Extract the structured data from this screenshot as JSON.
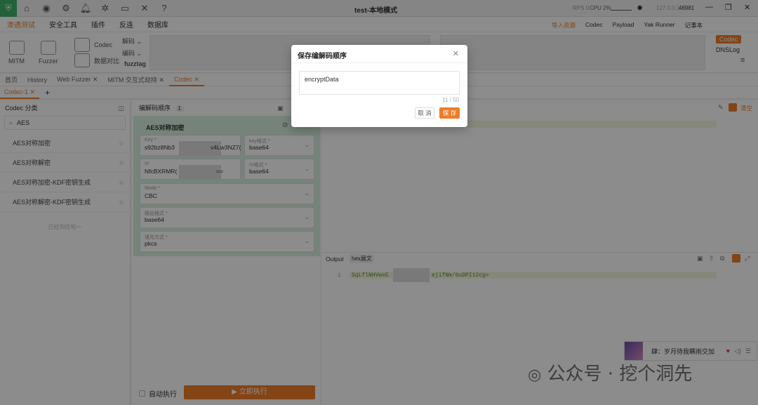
{
  "window": {
    "title": "test-本地模式",
    "rps": "RPS 0",
    "cpu": "CPU 2%",
    "ip": "127.0.0.1",
    "port": "46981"
  },
  "menu": [
    "渗透测试",
    "安全工具",
    "插件",
    "反连",
    "数据库"
  ],
  "right_menu": [
    "导入资源",
    "Codec",
    "Payload",
    "Yak Runner",
    "记事本"
  ],
  "tools": {
    "mitm": "MITM",
    "fuzzer": "Fuzzer",
    "codec": "Codec",
    "datacompare": "数据对比",
    "decode": "解码",
    "encode": "编码",
    "fuzztag": "fuzztag",
    "codec_tag": "Codec",
    "dnslog": "DNSLog"
  },
  "tabs": [
    "首页",
    "History",
    "Web Fuzzer",
    "MITM 交互式劫持",
    "Codec"
  ],
  "subtab": "Codec-1",
  "left_panel": {
    "title": "Codec 分类",
    "search_value": "AES",
    "items": [
      "AES对称加密",
      "AES对称解密",
      "AES对称加密-KDF密钥生成",
      "AES对称解密-KDF密钥生成"
    ],
    "footer": "已经到底啦～"
  },
  "mid_panel": {
    "title": "编解码顺序",
    "count": "1",
    "card_title": "AES对称加密",
    "fields": {
      "key_label": "Key *",
      "key_value_a": "s92bz8Nb3",
      "key_value_b": "v4Lw3NZ7(",
      "key_mode_label": "key格式 *",
      "key_mode": "base64",
      "iv_label": "IV",
      "iv_value_a": "NfcBXRMR(",
      "iv_value_b": "==",
      "iv_mode_label": "IV格式 *",
      "iv_mode": "base64",
      "mode_label": "Mode *",
      "mode": "CBC",
      "output_label": "输出格式 *",
      "output": "base64",
      "padding_label": "填充方式 *",
      "padding": "pkcs"
    },
    "auto_run": "自动执行",
    "run_now": "立即执行"
  },
  "right_panel": {
    "clear": "清空",
    "output_label": "Output",
    "hex_label": "hex展文",
    "line_no": "1",
    "output_a": "SqLflNHVwxE",
    "output_b": "ejifNm/6uDPI12cg="
  },
  "modal": {
    "title": "保存编解码顺序",
    "input_value": "encryptData",
    "counter": "11 / 50",
    "cancel": "取 消",
    "save": "保 存"
  },
  "music": {
    "title": "肆：岁月待我瞒雨交加"
  },
  "watermark": "公众号 · 挖个洞先"
}
